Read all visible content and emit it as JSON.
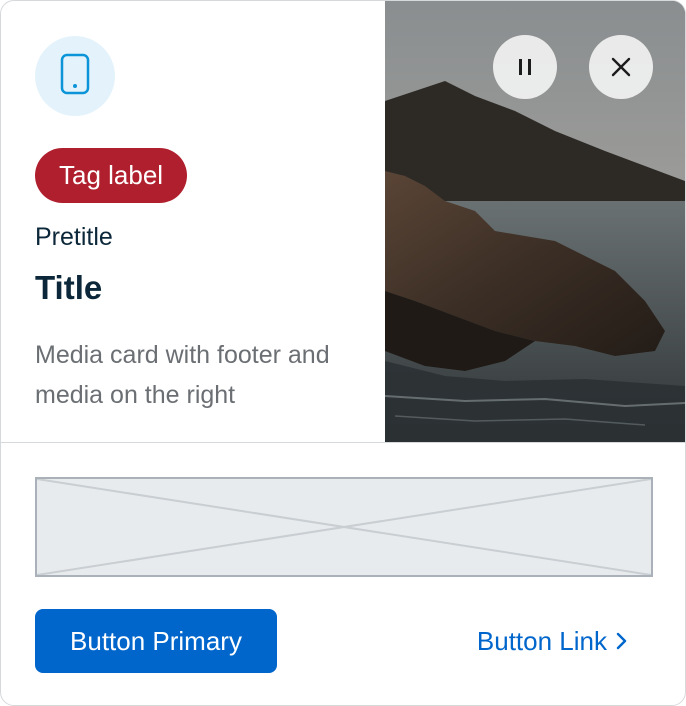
{
  "card": {
    "icon": "mobile-phone-icon",
    "tag_label": "Tag label",
    "pretitle": "Pretitle",
    "title": "Title",
    "description": "Media card with footer and media on the right"
  },
  "media": {
    "image": "coastal-rocks-sunset-photo",
    "pause_icon": "pause-icon",
    "close_icon": "close-icon"
  },
  "footer": {
    "slot": "placeholder-slot",
    "primary_button_label": "Button Primary",
    "link_button_label": "Button Link",
    "link_icon": "chevron-right-icon"
  },
  "colors": {
    "brand_primary": "#0066cc",
    "tag_background": "#b01f2e",
    "icon_background": "#e3f2fb",
    "icon_color": "#0b95d8",
    "text_primary": "#0b2739",
    "text_secondary": "#6b6f73"
  }
}
